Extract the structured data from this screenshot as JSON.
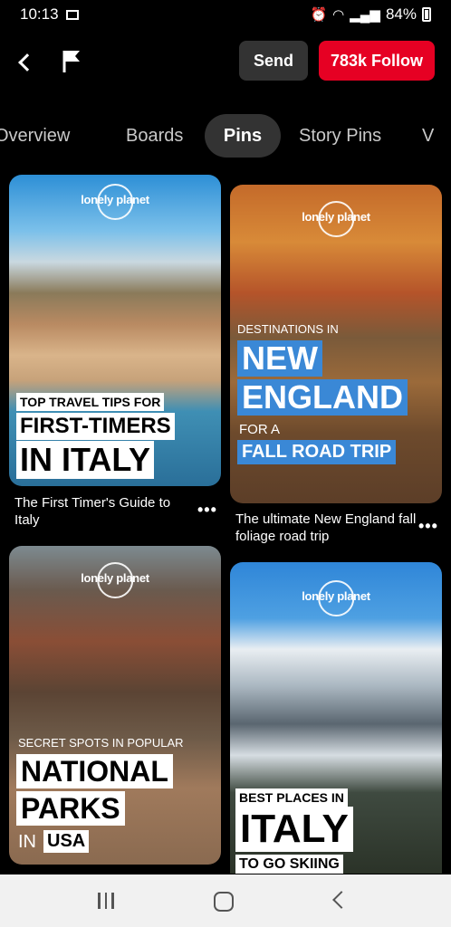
{
  "status_bar": {
    "time": "10:13",
    "battery": "84%",
    "icons": [
      "mail-icon",
      "alarm-icon",
      "wifi-icon",
      "signal-icon",
      "battery-icon"
    ]
  },
  "header": {
    "send_label": "Send",
    "follow_label": "783k Follow",
    "icons": [
      "back-arrow-icon",
      "flag-icon"
    ]
  },
  "tabs": [
    {
      "label": "Overview"
    },
    {
      "label": "Boards"
    },
    {
      "label": "Pins",
      "active": true
    },
    {
      "label": "Story Pins"
    },
    {
      "label": "V"
    }
  ],
  "pins": [
    {
      "logo": "lonely planet",
      "overlay": [
        "TOP TRAVEL TIPS FOR",
        "FIRST-TIMERS",
        "IN ITALY"
      ],
      "title": "The First Timer's Guide to Italy"
    },
    {
      "logo": "lonely planet",
      "overlay": [
        "DESTINATIONS IN",
        "NEW",
        "ENGLAND",
        "FOR A",
        "FALL ROAD TRIP"
      ],
      "title": "The ultimate New England fall foliage road trip"
    },
    {
      "logo": "lonely planet",
      "overlay": [
        "SECRET SPOTS IN POPULAR",
        "NATIONAL",
        "PARKS",
        "IN",
        "USA"
      ]
    },
    {
      "logo": "lonely planet",
      "overlay": [
        "BEST PLACES IN",
        "ITALY",
        "TO GO SKIING"
      ]
    }
  ],
  "more_label": "•••",
  "colors": {
    "accent": "#e60023",
    "background": "#000000",
    "tag_blue": "#3a88d6"
  }
}
